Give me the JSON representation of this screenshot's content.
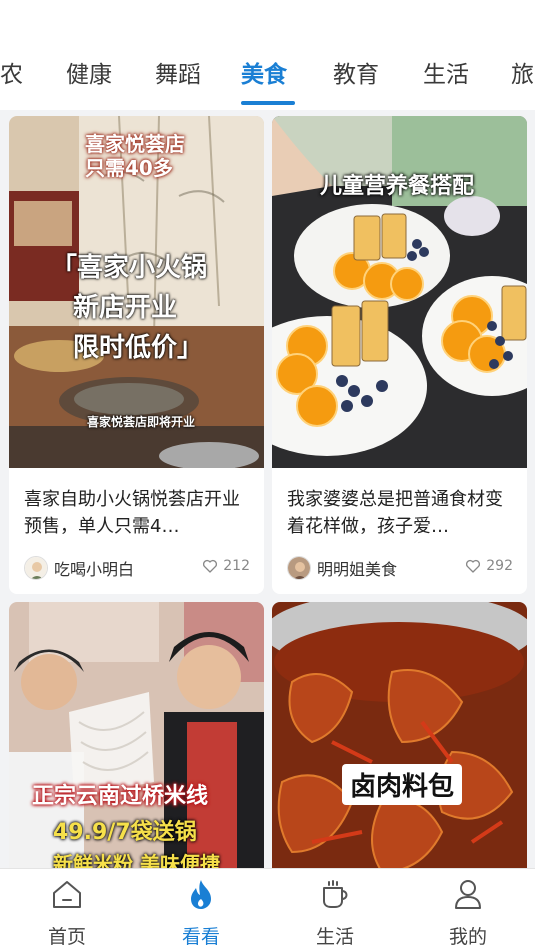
{
  "tabs": [
    {
      "label": "农"
    },
    {
      "label": "健康"
    },
    {
      "label": "舞蹈"
    },
    {
      "label": "美食",
      "active": true
    },
    {
      "label": "教育"
    },
    {
      "label": "生活"
    },
    {
      "label": "旅"
    }
  ],
  "cards": [
    {
      "title": "喜家自助小火锅悦荟店开业预售，单人只需4…",
      "author": "吃喝小明白",
      "likes": "212",
      "overlay": {
        "banner": "喜家悦荟店\n只需40多",
        "main1": "「喜家小火锅",
        "main2": "新店开业",
        "main3": "限时低价」",
        "caption": "喜家悦荟店即将开业"
      }
    },
    {
      "title": "我家婆婆总是把普通食材变着花样做，孩子爱…",
      "author": "明明姐美食",
      "likes": "292",
      "overlay": {
        "banner": "儿童营养餐搭配"
      }
    },
    {
      "title": "",
      "author": "",
      "likes": "",
      "overlay": {
        "line1": "正宗云南过桥米线",
        "line2": "49.9/7袋送锅",
        "line3": "新鲜米粉 美味便捷"
      }
    },
    {
      "title": "",
      "author": "",
      "likes": "",
      "overlay": {
        "label": "卤肉料包"
      }
    }
  ],
  "colors": {
    "accent": "#1a7fd4",
    "text": "#222222",
    "muted": "#888888"
  },
  "bottom_nav": [
    {
      "label": "首页",
      "icon": "home-icon"
    },
    {
      "label": "看看",
      "icon": "flame-icon",
      "active": true
    },
    {
      "label": "生活",
      "icon": "coffee-cup-icon"
    },
    {
      "label": "我的",
      "icon": "user-icon"
    }
  ]
}
